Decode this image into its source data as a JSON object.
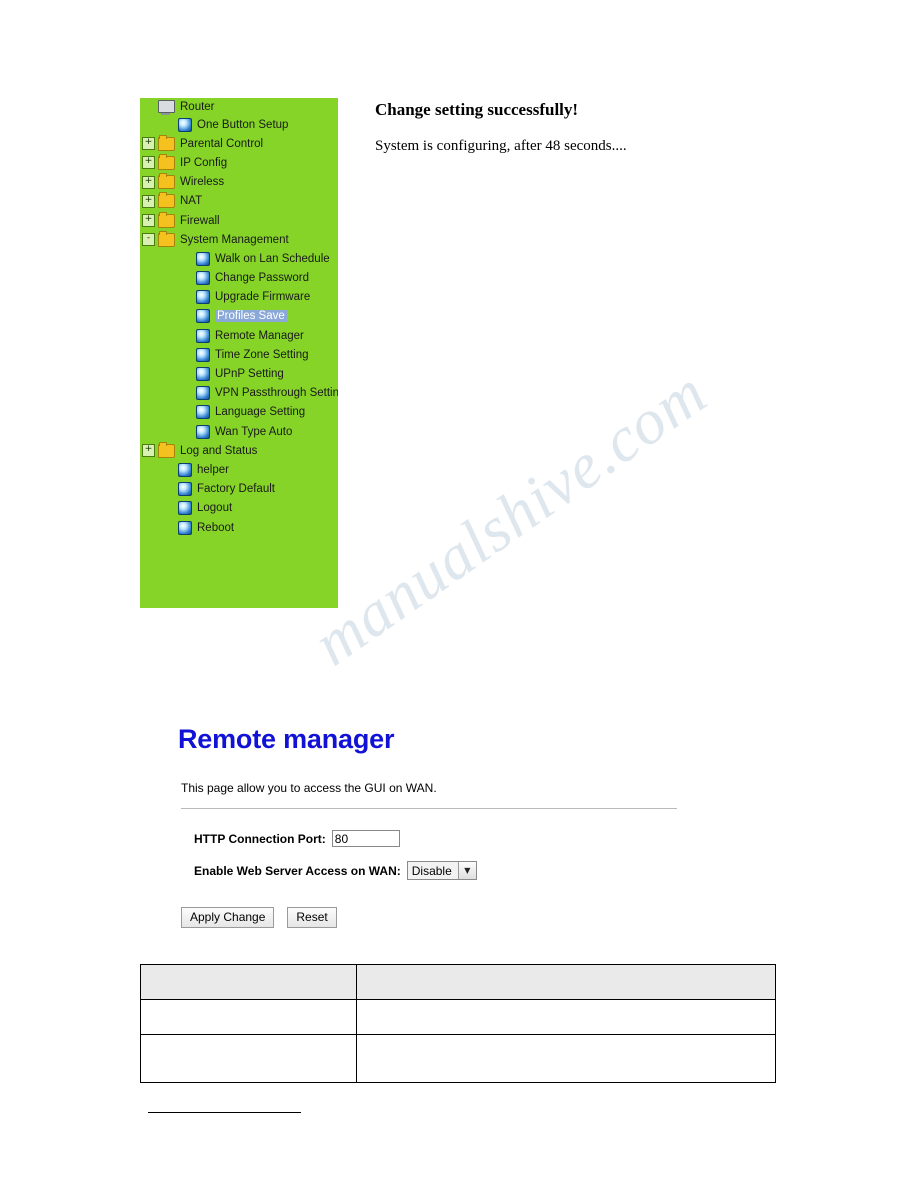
{
  "menu": {
    "items": [
      {
        "indent": 0,
        "expander": "",
        "icon": "pc-icon",
        "label": "Router",
        "selected": false,
        "clipped": true
      },
      {
        "indent": 1,
        "expander": "",
        "icon": "bullet",
        "label": "One Button Setup",
        "selected": false
      },
      {
        "indent": 0,
        "expander": "+",
        "icon": "folder",
        "label": "Parental Control",
        "selected": false
      },
      {
        "indent": 0,
        "expander": "+",
        "icon": "folder",
        "label": "IP Config",
        "selected": false
      },
      {
        "indent": 0,
        "expander": "+",
        "icon": "folder",
        "label": "Wireless",
        "selected": false
      },
      {
        "indent": 0,
        "expander": "+",
        "icon": "folder",
        "label": "NAT",
        "selected": false
      },
      {
        "indent": 0,
        "expander": "+",
        "icon": "folder",
        "label": "Firewall",
        "selected": false
      },
      {
        "indent": 0,
        "expander": "-",
        "icon": "folder",
        "label": "System Management",
        "selected": false
      },
      {
        "indent": 2,
        "expander": "",
        "icon": "bullet",
        "label": "Walk on Lan Schedule",
        "selected": false
      },
      {
        "indent": 2,
        "expander": "",
        "icon": "bullet",
        "label": "Change Password",
        "selected": false
      },
      {
        "indent": 2,
        "expander": "",
        "icon": "bullet",
        "label": "Upgrade Firmware",
        "selected": false
      },
      {
        "indent": 2,
        "expander": "",
        "icon": "bullet",
        "label": "Profiles Save",
        "selected": true
      },
      {
        "indent": 2,
        "expander": "",
        "icon": "bullet",
        "label": "Remote Manager",
        "selected": false
      },
      {
        "indent": 2,
        "expander": "",
        "icon": "bullet",
        "label": "Time Zone Setting",
        "selected": false
      },
      {
        "indent": 2,
        "expander": "",
        "icon": "bullet",
        "label": "UPnP Setting",
        "selected": false
      },
      {
        "indent": 2,
        "expander": "",
        "icon": "bullet",
        "label": "VPN Passthrough Setting",
        "selected": false
      },
      {
        "indent": 2,
        "expander": "",
        "icon": "bullet",
        "label": "Language Setting",
        "selected": false
      },
      {
        "indent": 2,
        "expander": "",
        "icon": "bullet",
        "label": "Wan Type Auto",
        "selected": false
      },
      {
        "indent": 0,
        "expander": "+",
        "icon": "folder",
        "label": "Log and Status",
        "selected": false
      },
      {
        "indent": 1,
        "expander": "",
        "icon": "bullet",
        "label": "helper",
        "selected": false
      },
      {
        "indent": 1,
        "expander": "",
        "icon": "bullet",
        "label": "Factory Default",
        "selected": false
      },
      {
        "indent": 1,
        "expander": "",
        "icon": "bullet",
        "label": "Logout",
        "selected": false
      },
      {
        "indent": 1,
        "expander": "",
        "icon": "bullet",
        "label": "Reboot",
        "selected": false
      }
    ]
  },
  "status": {
    "title": "Change setting successfully!",
    "message": "System is configuring, after 48 seconds...."
  },
  "remote_manager": {
    "title": "Remote manager",
    "description": "This page allow you to access the GUI on WAN.",
    "port_label": "HTTP Connection Port:",
    "port_value": "80",
    "wan_label": "Enable Web Server Access on WAN:",
    "wan_value": "Disable",
    "wan_arrow": "▼",
    "apply_label": "Apply Change",
    "reset_label": "Reset"
  },
  "table": {
    "rows": [
      {
        "c1": "",
        "c2": "",
        "header": true,
        "tall": false
      },
      {
        "c1": "",
        "c2": "",
        "header": false,
        "tall": false
      },
      {
        "c1": "",
        "c2": "",
        "header": false,
        "tall": true
      }
    ]
  },
  "watermark": {
    "text": "manualshive.com"
  },
  "colors": {
    "menu_background": "#85d427",
    "title_blue": "#1212d6",
    "selection_blue": "#8aa8d8"
  }
}
